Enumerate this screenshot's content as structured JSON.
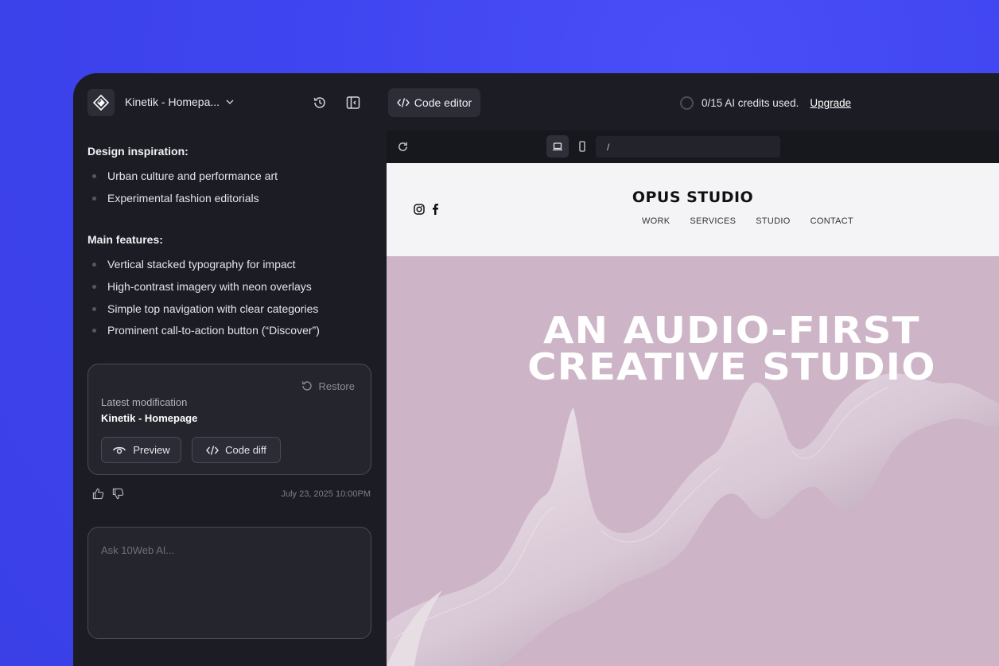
{
  "header": {
    "project_name": "Kinetik - Homepa...",
    "code_editor_label": "Code editor",
    "credits_text": "0/15 AI credits used.",
    "upgrade_label": "Upgrade"
  },
  "chat": {
    "design_title": "Design inspiration:",
    "design_items": [
      "Urban culture and performance art",
      "Experimental fashion editorials"
    ],
    "features_title": "Main features:",
    "feature_items": [
      "Vertical stacked typography for impact",
      "High-contrast imagery with neon overlays",
      "Simple top navigation with clear categories",
      "Prominent call-to-action button (“Discover”)"
    ],
    "restore_label": "Restore",
    "mod_label": "Latest modification",
    "mod_title": "Kinetik - Homepage",
    "preview_label": "Preview",
    "code_diff_label": "Code diff",
    "timestamp": "July 23, 2025 10:00PM",
    "prompt_placeholder": "Ask 10Web AI..."
  },
  "browser": {
    "url": "/"
  },
  "site": {
    "brand": "OPUS STUDIO",
    "nav": [
      "WORK",
      "SERVICES",
      "STUDIO",
      "CONTACT"
    ],
    "hero_line1": "AN AUDIO-FIRST",
    "hero_line2": "CREATIVE STUDIO"
  },
  "colors": {
    "background": "#3f45f0",
    "app_bg": "#1c1d24",
    "hero_bg": "#cdb4c6"
  }
}
